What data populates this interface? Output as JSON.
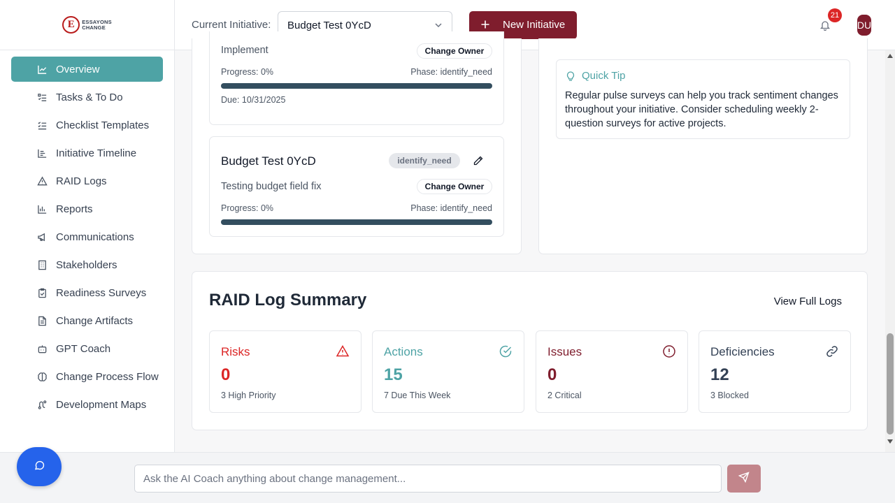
{
  "brand": {
    "logo_letter": "E",
    "line1": "ESSAYONS",
    "line2": "CHANGE"
  },
  "sidebar": {
    "items": [
      {
        "label": "Overview",
        "icon": "chart-line-icon"
      },
      {
        "label": "Tasks & To Do",
        "icon": "list-todo-icon"
      },
      {
        "label": "Checklist Templates",
        "icon": "list-checks-icon"
      },
      {
        "label": "Initiative Timeline",
        "icon": "timeline-icon"
      },
      {
        "label": "RAID Logs",
        "icon": "warning-icon"
      },
      {
        "label": "Reports",
        "icon": "bar-chart-icon"
      },
      {
        "label": "Communications",
        "icon": "megaphone-icon"
      },
      {
        "label": "Stakeholders",
        "icon": "building-icon"
      },
      {
        "label": "Readiness Surveys",
        "icon": "clipboard-check-icon"
      },
      {
        "label": "Change Artifacts",
        "icon": "file-text-icon"
      },
      {
        "label": "GPT Coach",
        "icon": "bot-icon"
      },
      {
        "label": "Change Process Flow",
        "icon": "brain-icon"
      },
      {
        "label": "Development Maps",
        "icon": "route-icon"
      }
    ]
  },
  "header": {
    "current_initiative_label": "Current Initiative:",
    "selected_initiative": "Budget Test 0YcD",
    "new_initiative_label": "New Initiative",
    "notification_count": "21",
    "avatar_initials": "DU"
  },
  "initiatives": [
    {
      "description": "Implement",
      "owner_button": "Change Owner",
      "progress_text": "Progress: 0%",
      "phase_text": "Phase: identify_need",
      "progress": 0,
      "due": "Due: 10/31/2025"
    },
    {
      "title": "Budget Test 0YcD",
      "phase_badge": "identify_need",
      "description": "Testing budget field fix",
      "owner_button": "Change Owner",
      "progress_text": "Progress: 0%",
      "phase_text": "Phase: identify_need",
      "progress": 0
    }
  ],
  "quick_tip": {
    "title": "Quick Tip",
    "text": "Regular pulse surveys can help you track sentiment changes throughout your initiative. Consider scheduling weekly 2-question surveys for active projects."
  },
  "raid": {
    "title": "RAID Log Summary",
    "view_full_logs": "View Full Logs",
    "stats": [
      {
        "title": "Risks",
        "value": "0",
        "sub": "3 High Priority",
        "color": "#dc2626",
        "icon": "alert-triangle-icon"
      },
      {
        "title": "Actions",
        "value": "15",
        "sub": "7 Due This Week",
        "color": "#4ea3a5",
        "icon": "check-circle-icon"
      },
      {
        "title": "Issues",
        "value": "0",
        "sub": "2 Critical",
        "color": "#7f1d2d",
        "icon": "alert-circle-icon"
      },
      {
        "title": "Deficiencies",
        "value": "12",
        "sub": "3 Blocked",
        "color": "#334155",
        "icon": "link-icon"
      }
    ]
  },
  "chat": {
    "placeholder": "Ask the AI Coach anything about change management..."
  },
  "colors": {
    "accent": "#4ea3a5",
    "brand": "#7f1d2d",
    "fab": "#2563eb"
  }
}
